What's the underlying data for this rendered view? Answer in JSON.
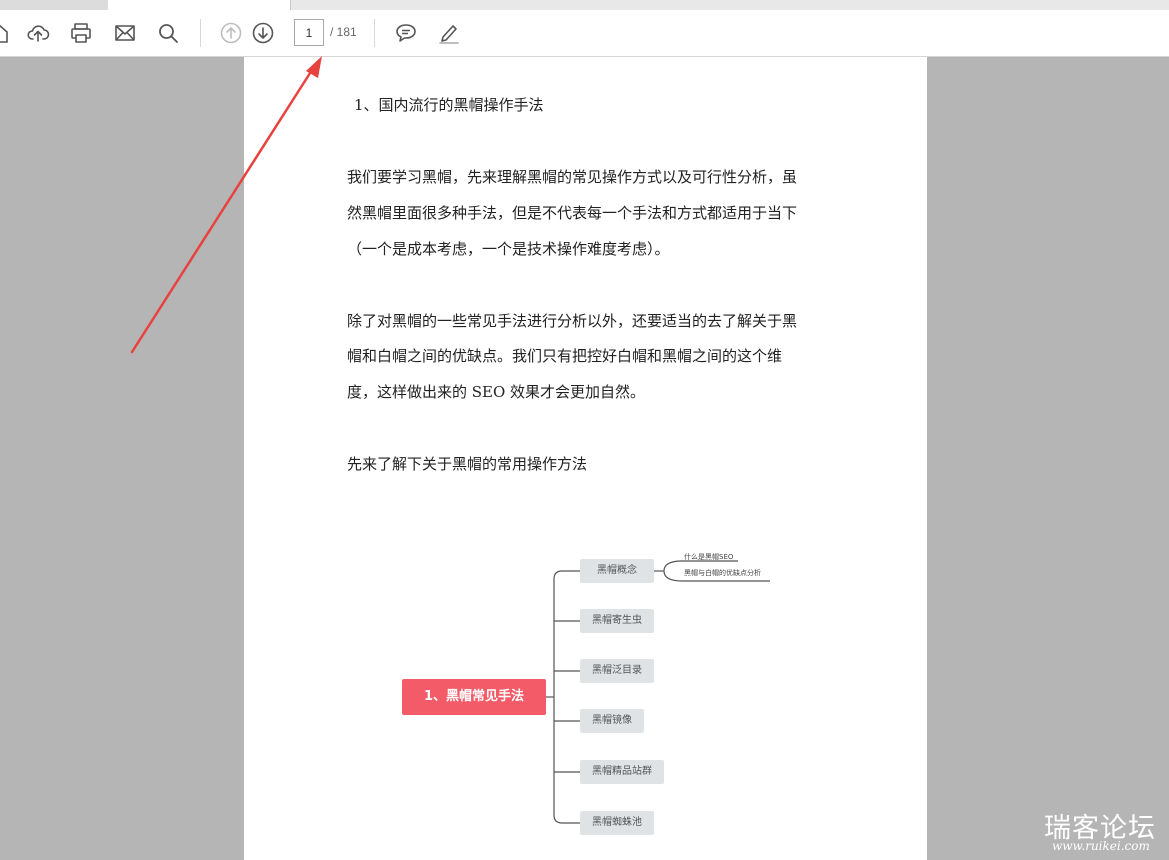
{
  "toolbar": {
    "icons": [
      "home-icon",
      "upload-icon",
      "print-icon",
      "email-icon",
      "search-icon",
      "page-up-icon",
      "page-down-icon",
      "comment-icon",
      "highlight-pen-icon"
    ],
    "page_current": "1",
    "page_total": "/ 181"
  },
  "document": {
    "heading": "1、国内流行的黑帽操作手法",
    "paragraph1": [
      "我们要学习黑帽，先来理解黑帽的常见操作方式以及可行性分析，虽",
      "然黑帽里面很多种手法，但是不代表每一个手法和方式都适用于当下",
      "（一个是成本考虑，一个是技术操作难度考虑）。"
    ],
    "paragraph2": [
      "除了对黑帽的一些常见手法进行分析以外，还要适当的去了解关于黑",
      "帽和白帽之间的优缺点。我们只有把控好白帽和黑帽之间的这个维",
      "度，这样做出来的 SEO 效果才会更加自然。"
    ],
    "paragraph3": "先来了解下关于黑帽的常用操作方法",
    "mindmap": {
      "root": "1、黑帽常见手法",
      "branches": [
        "黑帽概念",
        "黑帽寄生虫",
        "黑帽泛目录",
        "黑帽镜像",
        "黑帽精品站群",
        "黑帽蜘蛛池"
      ],
      "leaves": [
        "什么是黑帽SEO",
        "黑帽与白帽的优缺点分析"
      ]
    }
  },
  "annotation": {
    "color": "#e8423f"
  },
  "watermark": {
    "title": "瑞客论坛",
    "url": "www.ruikei.com"
  }
}
